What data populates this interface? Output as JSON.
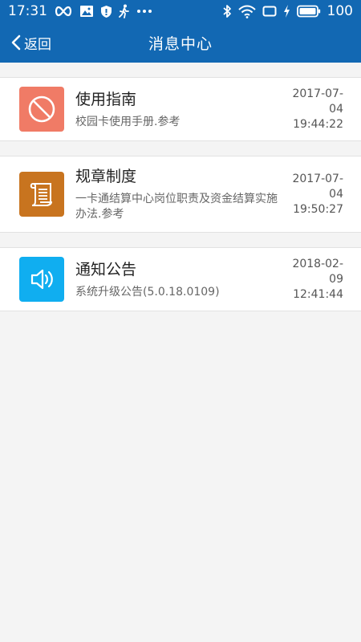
{
  "status_bar": {
    "time": "17:31",
    "battery": "100",
    "left_icons": [
      "infinity-icon",
      "image-icon",
      "shield-icon",
      "walking-icon",
      "more-dots-icon"
    ],
    "right_icons": [
      "bluetooth-icon",
      "wifi-icon",
      "screen-icon",
      "charging-icon",
      "battery-icon"
    ]
  },
  "header": {
    "back_label": "返回",
    "title": "消息中心"
  },
  "messages": [
    {
      "title": "使用指南",
      "subtitle": "校园卡使用手册.参考",
      "date": "2017-07-04",
      "time": "19:44:22",
      "icon": "compass-icon",
      "icon_color": "#f07b66"
    },
    {
      "title": "规章制度",
      "subtitle": "一卡通结算中心岗位职责及资金结算实施办法.参考",
      "date": "2017-07-04",
      "time": "19:50:27",
      "icon": "scroll-icon",
      "icon_color": "#c8741f"
    },
    {
      "title": "通知公告",
      "subtitle": "系统升级公告(5.0.18.0109)",
      "date": "2018-02-09",
      "time": "12:41:44",
      "icon": "speaker-icon",
      "icon_color": "#10aef0"
    }
  ],
  "colors": {
    "primary": "#1268b3",
    "background": "#f4f4f4"
  }
}
